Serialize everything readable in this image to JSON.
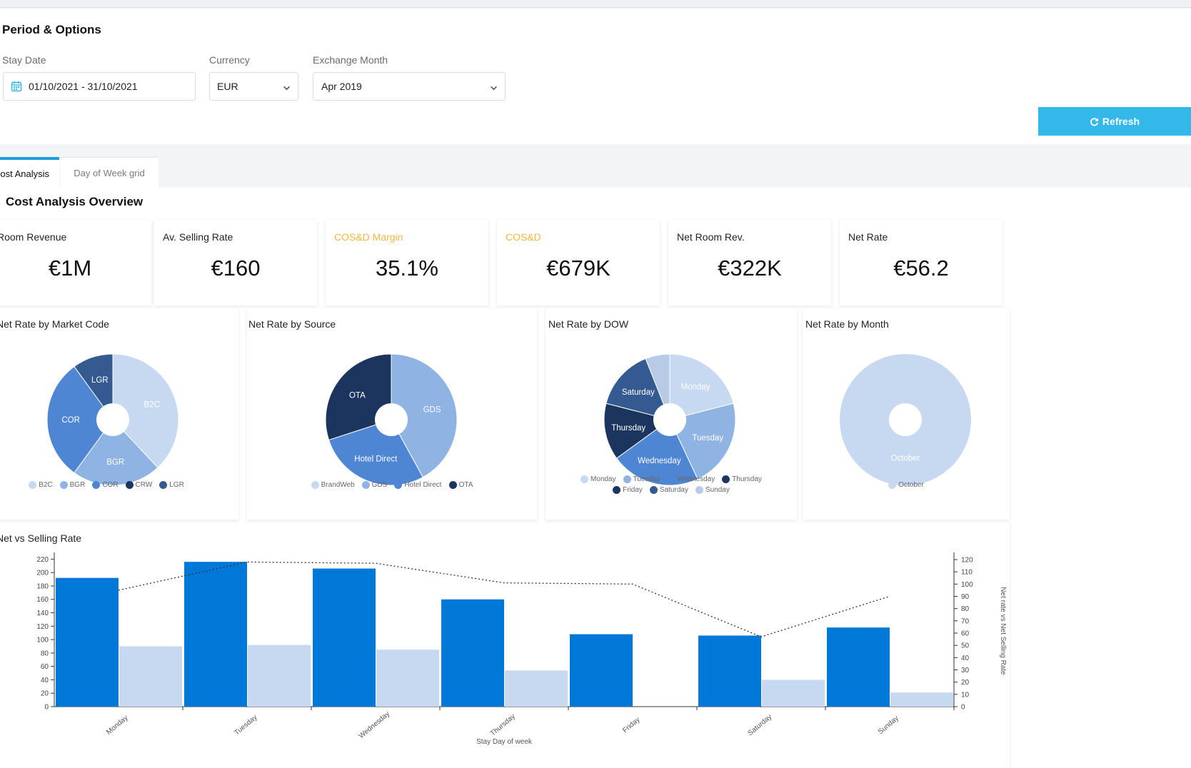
{
  "options": {
    "title": "Period & Options",
    "stay_date": {
      "label": "Stay Date",
      "value": "01/10/2021 - 31/10/2021"
    },
    "currency": {
      "label": "Currency",
      "value": "EUR"
    },
    "exchange_month": {
      "label": "Exchange Month",
      "value": "Apr 2019"
    },
    "refresh_label": "Refresh"
  },
  "tabs": [
    {
      "label": "Cost Analysis",
      "active": true
    },
    {
      "label": "Day of Week grid",
      "active": false
    }
  ],
  "overview_title": "Cost Analysis Overview",
  "kpis": [
    {
      "label": "Room Revenue",
      "value": "€1M",
      "highlight": false
    },
    {
      "label": "Av. Selling Rate",
      "value": "€160",
      "highlight": false
    },
    {
      "label": "COS&D Margin",
      "value": "35.1%",
      "highlight": true
    },
    {
      "label": "COS&D",
      "value": "€679K",
      "highlight": true
    },
    {
      "label": "Net Room Rev.",
      "value": "€322K",
      "highlight": false
    },
    {
      "label": "Net Rate",
      "value": "€56.2",
      "highlight": false
    }
  ],
  "colors": {
    "accent": "#34b7e9",
    "tab_active": "#1f9be0",
    "warning_label": "#f5b63f",
    "bar_selling": "#0078d7",
    "bar_net": "#c6d9f1"
  },
  "chart_data": [
    {
      "type": "pie",
      "title": "Net Rate by Market Code",
      "slices": [
        {
          "label": "B2C",
          "value": 38,
          "color": "#c6d9f1"
        },
        {
          "label": "BGR",
          "value": 22,
          "color": "#8fb4e3"
        },
        {
          "label": "COR",
          "value": 30,
          "color": "#4f86d4"
        },
        {
          "label": "CRW",
          "value": 0,
          "color": "#1c355e"
        },
        {
          "label": "LGR",
          "value": 10,
          "color": "#355a91"
        }
      ]
    },
    {
      "type": "pie",
      "title": "Net Rate by Source",
      "slices": [
        {
          "label": "BrandWeb",
          "value": 0,
          "color": "#c6d9f1"
        },
        {
          "label": "GDS",
          "value": 42,
          "color": "#8fb4e3"
        },
        {
          "label": "Hotel Direct",
          "value": 28,
          "color": "#4f86d4"
        },
        {
          "label": "OTA",
          "value": 30,
          "color": "#1c355e"
        }
      ]
    },
    {
      "type": "pie",
      "title": "Net Rate by DOW",
      "slices": [
        {
          "label": "Monday",
          "value": 21,
          "color": "#c6d9f1"
        },
        {
          "label": "Tuesday",
          "value": 22,
          "color": "#8fb4e3"
        },
        {
          "label": "Wednesday",
          "value": 22,
          "color": "#4f86d4"
        },
        {
          "label": "Thursday",
          "value": 14,
          "color": "#1c355e"
        },
        {
          "label": "Friday",
          "value": 0,
          "color": "#1c355e"
        },
        {
          "label": "Saturday",
          "value": 15,
          "color": "#355a91"
        },
        {
          "label": "Sunday",
          "value": 6,
          "color": "#b7cbe6"
        }
      ]
    },
    {
      "type": "pie",
      "title": "Net Rate by Month",
      "slices": [
        {
          "label": "October",
          "value": 100,
          "color": "#c6d9f1"
        }
      ]
    },
    {
      "type": "bar",
      "title": "Net vs Selling Rate",
      "xlabel": "Stay Day of week",
      "ylabel_right": "Net rate vs Net Selling Rate",
      "categories": [
        "Monday",
        "Tuesday",
        "Wednesday",
        "Thursday",
        "Friday",
        "Saturday",
        "Sunday"
      ],
      "ylim": [
        0,
        230
      ],
      "yticks": [
        0,
        20,
        40,
        60,
        80,
        100,
        120,
        140,
        160,
        180,
        200,
        220
      ],
      "y2lim": [
        0,
        120
      ],
      "y2ticks": [
        0,
        10,
        20,
        30,
        40,
        50,
        60,
        70,
        80,
        90,
        100,
        110,
        120
      ],
      "series": [
        {
          "values": [
            192,
            216,
            206,
            160,
            108,
            106,
            118
          ],
          "color": "#0078d7"
        },
        {
          "values": [
            90,
            92,
            85,
            54,
            0,
            40,
            21
          ],
          "color": "#c6d9f1"
        },
        {
          "values": [
            95,
            118,
            117,
            101,
            100,
            57,
            90
          ],
          "color": "#333333",
          "line": "dotted",
          "axis": "right"
        }
      ]
    }
  ]
}
